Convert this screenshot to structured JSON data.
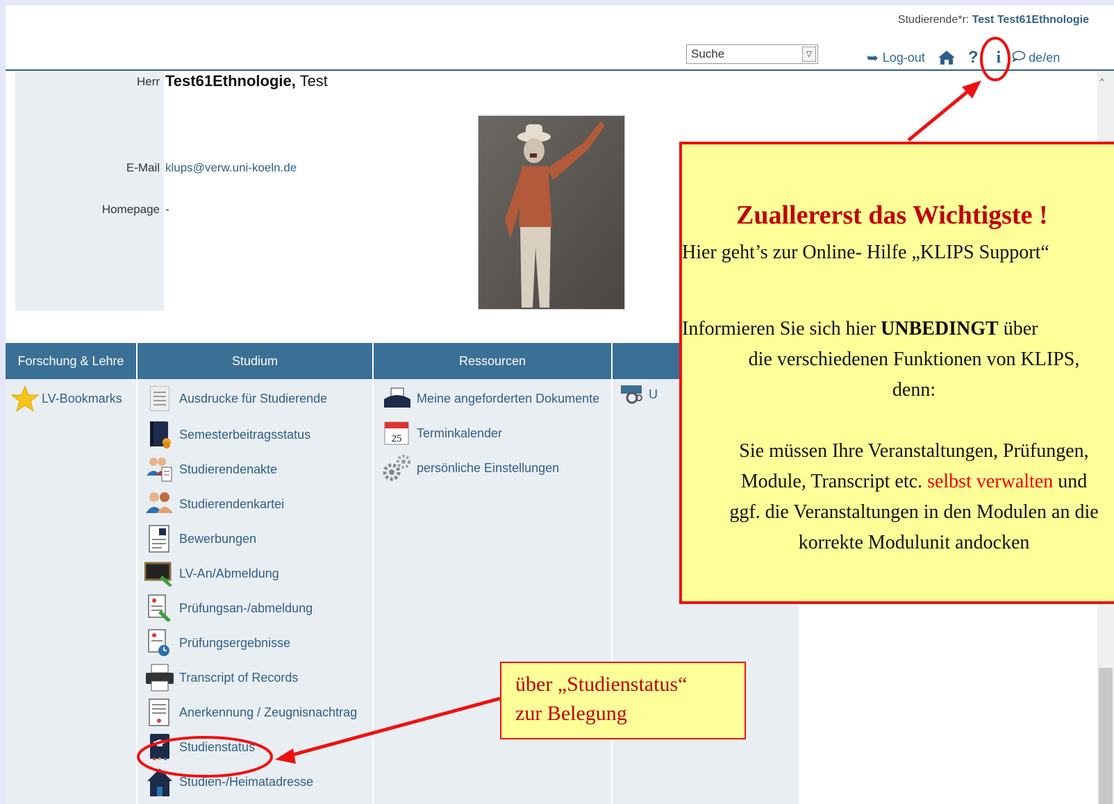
{
  "header": {
    "user_label": "Studierende*r:",
    "user_name": "Test Test61Ethnologie",
    "search_value": "Suche",
    "logout_label": "Log-out",
    "lang_label": "de/en"
  },
  "person": {
    "salutation": "Herr",
    "last_name": "Test61Ethnologie,",
    "first_name": "Test",
    "email_label": "E-Mail",
    "email_value": "klups@verw.uni-koeln.de",
    "homepage_label": "Homepage",
    "homepage_value": "-"
  },
  "menu": {
    "columns": [
      {
        "title": "Forschung & Lehre"
      },
      {
        "title": "Studium"
      },
      {
        "title": "Ressourcen"
      }
    ],
    "forschung": [
      {
        "label": "LV-Bookmarks",
        "icon": "star-icon"
      }
    ],
    "studium": [
      {
        "label": "Ausdrucke für Studierende",
        "icon": "document-icon"
      },
      {
        "label": "Semesterbeitragsstatus",
        "icon": "book-coins-icon"
      },
      {
        "label": "Studierendenakte",
        "icon": "people-file-icon"
      },
      {
        "label": "Studierendenkartei",
        "icon": "people-icon"
      },
      {
        "label": "Bewerbungen",
        "icon": "application-icon"
      },
      {
        "label": "LV-An/Abmeldung",
        "icon": "blackboard-icon"
      },
      {
        "label": "Prüfungsan-/abmeldung",
        "icon": "exam-register-icon"
      },
      {
        "label": "Prüfungsergebnisse",
        "icon": "exam-results-icon"
      },
      {
        "label": "Transcript of Records",
        "icon": "printer-icon"
      },
      {
        "label": "Anerkennung / Zeugnisnachtrag",
        "icon": "certificate-icon"
      },
      {
        "label": "Studienstatus",
        "icon": "graduation-book-icon"
      },
      {
        "label": "Studien-/Heimatadresse",
        "icon": "house-icon"
      }
    ],
    "ressourcen": [
      {
        "label": "Meine angeforderten Dokumente",
        "icon": "printer-docs-icon"
      },
      {
        "label": "Terminkalender",
        "icon": "calendar-icon"
      },
      {
        "label": "persönliche Einstellungen",
        "icon": "gears-icon"
      }
    ],
    "calendar_day": "25",
    "fourth_col_item": "U"
  },
  "callout_big": {
    "title": "Zuallererst das Wichtigste !",
    "line1": "Hier geht’s zur Online- Hilfe „KLIPS Support“",
    "line2_pre": "Informieren Sie sich hier ",
    "line2_bold": "UNBEDINGT",
    "line2_post": " über",
    "line3": "die verschiedenen Funktionen von KLIPS,",
    "line4": "denn:",
    "line5": "Sie müssen Ihre Veranstaltungen, Prüfungen,",
    "line6_pre": "Module, Transcript etc. ",
    "line6_red": "selbst verwalten",
    "line6_post": " und",
    "line7": "ggf. die Veranstaltungen in den Modulen an die",
    "line8": "korrekte Modulunit andocken"
  },
  "callout_small": {
    "line1": "über „Studienstatus“",
    "line2": "zur Belegung"
  },
  "colors": {
    "accent": "#3a6f96",
    "link": "#2f5f86",
    "callout_bg": "#ffff99",
    "callout_border": "#ee1111"
  }
}
